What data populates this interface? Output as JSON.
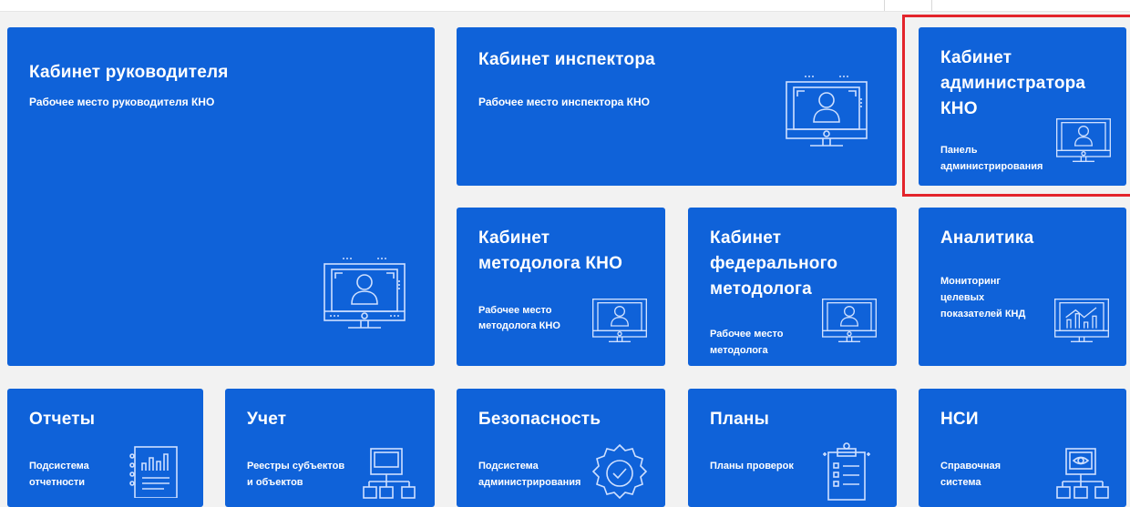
{
  "colors": {
    "tile": "#0f62d9",
    "background": "#f2f2f2",
    "highlight": "#e3242b"
  },
  "tiles": {
    "head": {
      "title": "Кабинет руководителя",
      "subtitle": "Рабочее место руководителя КНО",
      "icon": "monitor-user-icon"
    },
    "inspector": {
      "title": "Кабинет инспектора",
      "subtitle": "Рабочее место инспектора КНО",
      "icon": "monitor-user-icon"
    },
    "admin": {
      "title_lines": [
        "Кабинет",
        "администратора",
        "КНО"
      ],
      "subtitle_lines": [
        "Панель",
        "администрирования"
      ],
      "icon": "monitor-user-icon"
    },
    "methodologist": {
      "title_lines": [
        "Кабинет",
        "методолога КНО"
      ],
      "subtitle_lines": [
        "Рабочее место",
        "методолога КНО"
      ],
      "icon": "monitor-user-icon"
    },
    "federal": {
      "title_lines": [
        "Кабинет",
        "федерального",
        "методолога"
      ],
      "subtitle_lines": [
        "Рабочее место",
        "методолога"
      ],
      "icon": "monitor-user-icon"
    },
    "analytics": {
      "title": "Аналитика",
      "subtitle_lines": [
        "Мониторинг",
        "целевых",
        "показателей КНД"
      ],
      "icon": "monitor-chart-icon"
    },
    "reports": {
      "title": "Отчеты",
      "subtitle_lines": [
        "Подсистема",
        "отчетности"
      ],
      "icon": "report-icon"
    },
    "accounting": {
      "title": "Учет",
      "subtitle_lines": [
        "Реестры субъектов",
        "и объектов"
      ],
      "icon": "registry-icon"
    },
    "security": {
      "title": "Безопасность",
      "subtitle_lines": [
        "Подсистема",
        "администрирования"
      ],
      "icon": "gear-check-icon"
    },
    "plans": {
      "title": "Планы",
      "subtitle": "Планы проверок",
      "icon": "clipboard-icon"
    },
    "nsi": {
      "title": "НСИ",
      "subtitle_lines": [
        "Справочная",
        "система"
      ],
      "icon": "reference-icon"
    }
  }
}
